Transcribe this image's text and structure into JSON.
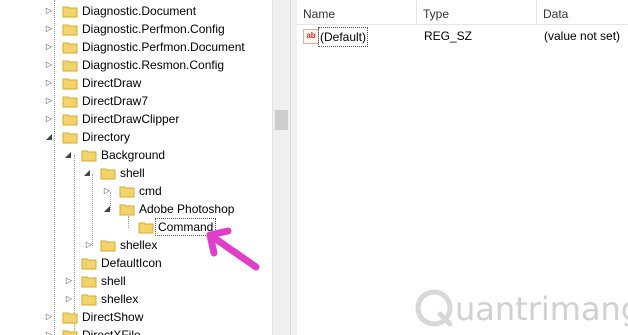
{
  "tree": {
    "items": [
      {
        "label": "Diagnostic.Document"
      },
      {
        "label": "Diagnostic.Perfmon.Config"
      },
      {
        "label": "Diagnostic.Perfmon.Document"
      },
      {
        "label": "Diagnostic.Resmon.Config"
      },
      {
        "label": "DirectDraw"
      },
      {
        "label": "DirectDraw7"
      },
      {
        "label": "DirectDrawClipper"
      },
      {
        "label": "Directory"
      },
      {
        "label": "Background"
      },
      {
        "label": "shell"
      },
      {
        "label": "cmd"
      },
      {
        "label": "Adobe Photoshop"
      },
      {
        "label": "Command"
      },
      {
        "label": "shellex"
      },
      {
        "label": "DefaultIcon"
      },
      {
        "label": "shell"
      },
      {
        "label": "shellex"
      },
      {
        "label": "DirectShow"
      },
      {
        "label": "DirectXFile"
      }
    ]
  },
  "list": {
    "columns": {
      "name": "Name",
      "type": "Type",
      "data": "Data"
    },
    "rows": [
      {
        "icon": "ab",
        "name": "(Default)",
        "type": "REG_SZ",
        "data": "(value not set)"
      }
    ]
  },
  "watermark": {
    "text": "uantrimang"
  },
  "colors": {
    "arrow": "#e040c8",
    "folder": "#f3d36b",
    "folder_dark": "#d9a92e"
  }
}
